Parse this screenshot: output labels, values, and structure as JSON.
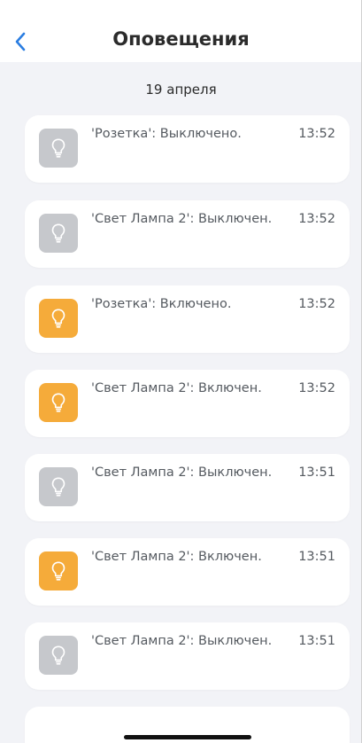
{
  "header": {
    "title": "Оповещения"
  },
  "date_group": "19 апреля",
  "colors": {
    "accent": "#2a7de1",
    "icon_on": "#f5ab3a",
    "icon_off": "#c6c8cc"
  },
  "notifications": [
    {
      "message": "'Розетка': Выключено.",
      "time": "13:52",
      "state": "off",
      "icon": "lightbulb-icon"
    },
    {
      "message": "'Свет Лампа 2': Выключен.",
      "time": "13:52",
      "state": "off",
      "icon": "lightbulb-icon"
    },
    {
      "message": "'Розетка': Включено.",
      "time": "13:52",
      "state": "on",
      "icon": "lightbulb-icon"
    },
    {
      "message": "'Свет Лампа 2': Включен.",
      "time": "13:52",
      "state": "on",
      "icon": "lightbulb-icon"
    },
    {
      "message": "'Свет Лампа 2': Выключен.",
      "time": "13:51",
      "state": "off",
      "icon": "lightbulb-icon"
    },
    {
      "message": "'Свет Лампа 2': Включен.",
      "time": "13:51",
      "state": "on",
      "icon": "lightbulb-icon"
    },
    {
      "message": "'Свет Лампа 2': Выключен.",
      "time": "13:51",
      "state": "off",
      "icon": "lightbulb-icon"
    }
  ]
}
